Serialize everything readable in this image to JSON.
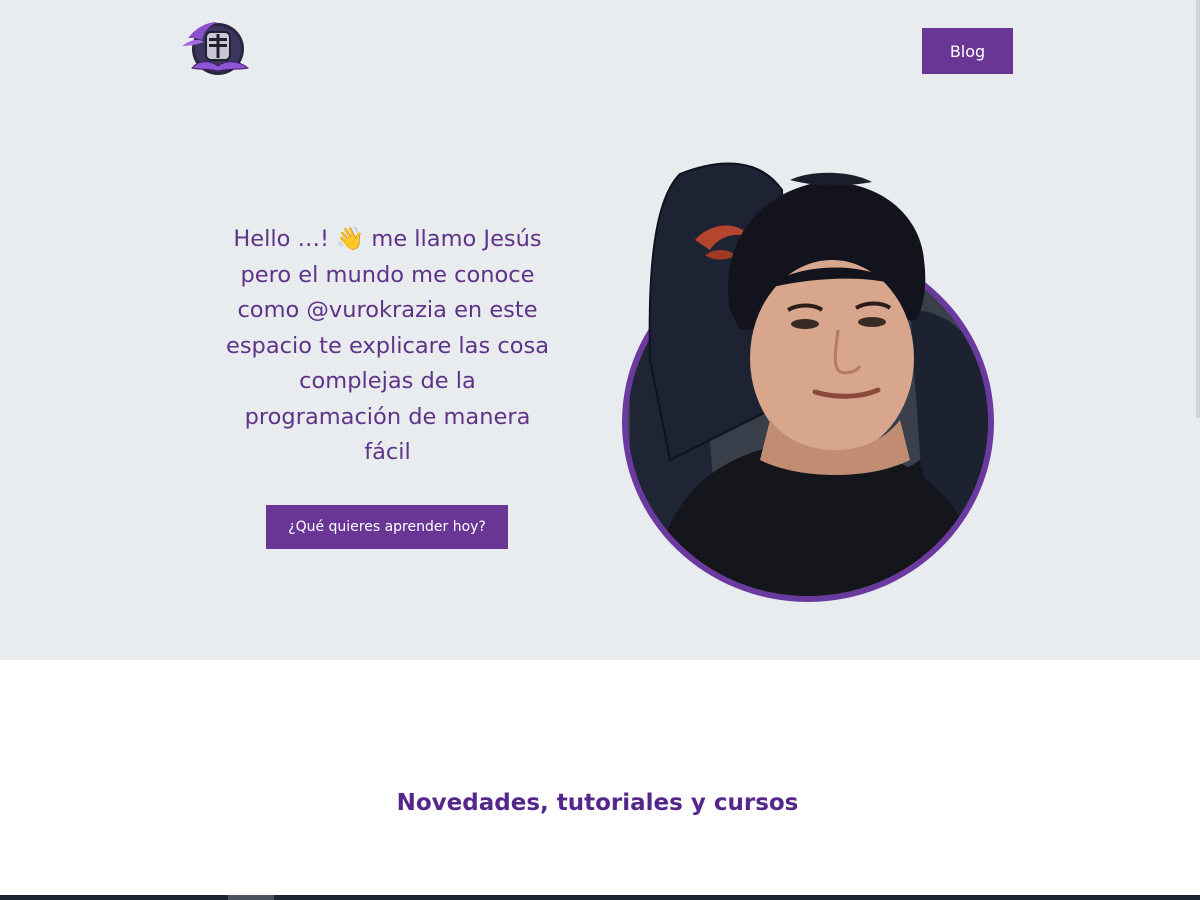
{
  "header": {
    "logo_icon": "knight-helmet-mustache-logo-icon",
    "blog_label": "Blog"
  },
  "hero": {
    "intro_lines": [
      "Hello …! 👋 me llamo Jesús",
      "pero el mundo me conoce",
      "como @vurokrazia en este",
      "espacio te explicare las cosa",
      "complejas de la",
      "programación de manera",
      "fácil"
    ],
    "cta_label": "¿Qué quieres aprender hoy?",
    "portrait_icon": "profile-photo-icon"
  },
  "section": {
    "title": "Novedades, tutoriales y cursos"
  },
  "colors": {
    "accent": "#6a3696",
    "text_purple": "#5e3388",
    "hero_bg": "#e9ecee"
  }
}
